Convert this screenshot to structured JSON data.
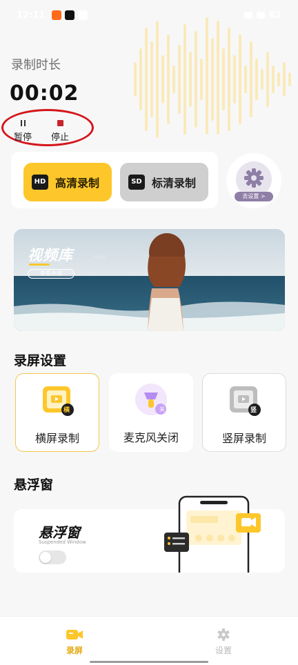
{
  "status_bar": {
    "time": "12:11",
    "battery": "82"
  },
  "recording": {
    "label": "录制时长",
    "duration": "00:02",
    "pause_label": "暂停",
    "stop_label": "停止"
  },
  "quality": {
    "hd_badge": "HD",
    "hd_label": "高清录制",
    "sd_badge": "SD",
    "sd_label": "标清录制",
    "settings_pill": "去设置 >"
  },
  "banner": {
    "title": "视频库",
    "subtitle": "VIDEO",
    "button": "查看全部"
  },
  "screen_settings": {
    "title": "录屏设置",
    "options": [
      {
        "label": "横屏录制",
        "badge": "横"
      },
      {
        "label": "麦克风关闭",
        "badge": "关"
      },
      {
        "label": "竖屏录制",
        "badge": "竖"
      }
    ]
  },
  "floating": {
    "section_title": "悬浮窗",
    "card_title": "悬浮窗",
    "card_subtitle": "Suspended Window"
  },
  "nav": {
    "record": "录屏",
    "settings": "设置"
  },
  "colors": {
    "accent": "#fdc72b",
    "accent_text": "#e6a912",
    "stop": "#c8242b",
    "highlight_ring": "#d4161c"
  }
}
